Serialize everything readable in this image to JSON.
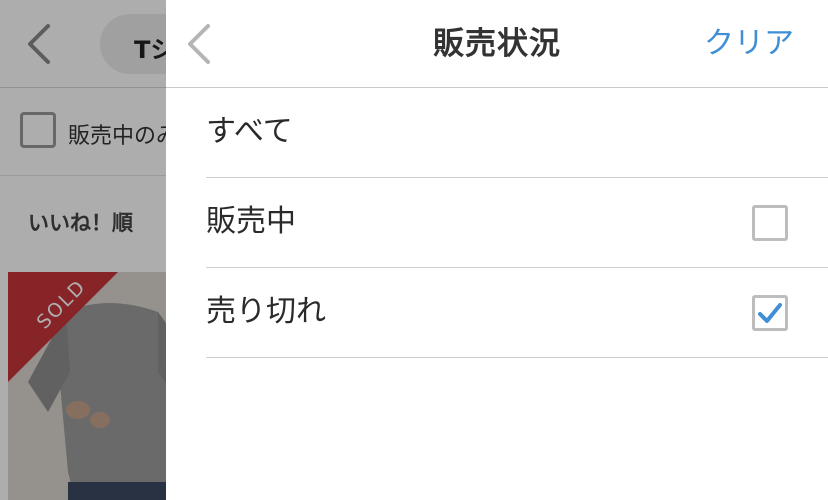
{
  "background_page": {
    "search_text": "Tシャツ",
    "filter_checkbox_label": "販売中のみ表示",
    "sort_label": "いいね！順",
    "product_badge": "SOLD"
  },
  "panel": {
    "title": "販売状況",
    "clear_label": "クリア",
    "options": [
      {
        "label": "すべて",
        "has_checkbox": false,
        "checked": false
      },
      {
        "label": "販売中",
        "has_checkbox": true,
        "checked": false
      },
      {
        "label": "売り切れ",
        "has_checkbox": true,
        "checked": true
      }
    ]
  },
  "colors": {
    "accent": "#3f8ed6",
    "sold_badge": "#c8363c",
    "overlay": "rgba(0,0,0,0.32)"
  },
  "icons": {
    "back": "chevron-left-icon",
    "check": "checkmark-icon"
  }
}
